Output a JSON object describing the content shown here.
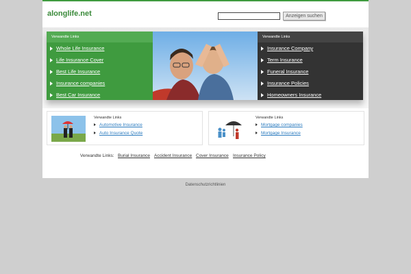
{
  "header": {
    "logo_text": "alonglife.net",
    "search_placeholder": "",
    "search_button": "Anzeigen suchen"
  },
  "hero": {
    "left_title": "Verwandte Links",
    "left_links": [
      "Whole Life Insurance",
      "Life Insurance Cover",
      "Best Life Insurance",
      "Insurance companies",
      "Best Car Insurance"
    ],
    "right_title": "Verwandte Links",
    "right_links": [
      "Insurance Company",
      "Term Insurance",
      "Funeral Insurance",
      "Insurance Policies",
      "Homeowners Insurance"
    ]
  },
  "boxes": [
    {
      "title": "Verwandte Links",
      "links": [
        "Automotive Insurance",
        "Auto Insurance Quote"
      ]
    },
    {
      "title": "Verwandte Links",
      "links": [
        "Mortgage companies",
        "Mortgage Insurance"
      ]
    }
  ],
  "related": {
    "label": "Verwandte Links:",
    "links": [
      "Burial Insurance",
      "Accident Insurance",
      "Cover Insurance",
      "Insurance Policy"
    ]
  },
  "footer": {
    "privacy": "Datenschutzrichtlinien"
  },
  "colors": {
    "green": "#3f9b3f",
    "dark": "#333333",
    "link_blue": "#2b7bbf",
    "background": "#cfcfcf"
  }
}
